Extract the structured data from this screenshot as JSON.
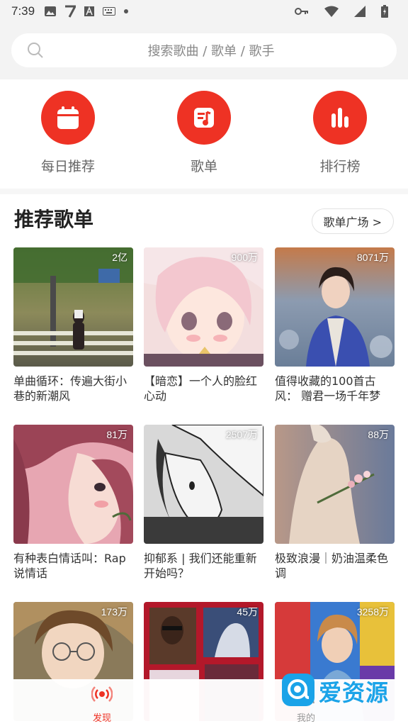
{
  "status_bar": {
    "time": "7:39",
    "left_icons": [
      "image-icon",
      "seven-icon",
      "a-icon",
      "keyboard-icon",
      "dot-icon"
    ],
    "right_icons": [
      "key-icon",
      "wifi-icon",
      "signal-icon",
      "battery-icon"
    ]
  },
  "search": {
    "placeholder": "搜索歌曲 / 歌单 / 歌手"
  },
  "quick_menu": [
    {
      "label": "每日推荐",
      "icon": "calendar-icon"
    },
    {
      "label": "歌单",
      "icon": "playlist-icon"
    },
    {
      "label": "排行榜",
      "icon": "chart-icon"
    }
  ],
  "section": {
    "title": "推荐歌单",
    "more_label": "歌单广场 >"
  },
  "playlists": [
    {
      "count": "2亿",
      "title": "单曲循环：传遍大街小巷的新潮风"
    },
    {
      "count": "900万",
      "title": "【暗恋】一个人的脸红心动"
    },
    {
      "count": "8071万",
      "title": "值得收藏的100首古风： 赠君一场千年梦"
    },
    {
      "count": "81万",
      "title": "有种表白情话叫：Rap说情话"
    },
    {
      "count": "2507万",
      "title": "抑郁系 | 我们还能重新开始吗？"
    },
    {
      "count": "88万",
      "title": "极致浪漫｜奶油温柔色调"
    },
    {
      "count": "173万",
      "title": ""
    },
    {
      "count": "45万",
      "title": ""
    },
    {
      "count": "3258万",
      "title": ""
    }
  ],
  "bottom_nav": [
    {
      "label": "发现",
      "icon": "radio-icon",
      "active": true
    },
    {
      "label": "我的",
      "icon": "user-icon",
      "active": false
    }
  ],
  "watermark": {
    "text": "爱资源"
  },
  "colors": {
    "accent": "#ee3224",
    "header_bg": "#f3f3f3",
    "watermark": "#1aa3e8"
  }
}
